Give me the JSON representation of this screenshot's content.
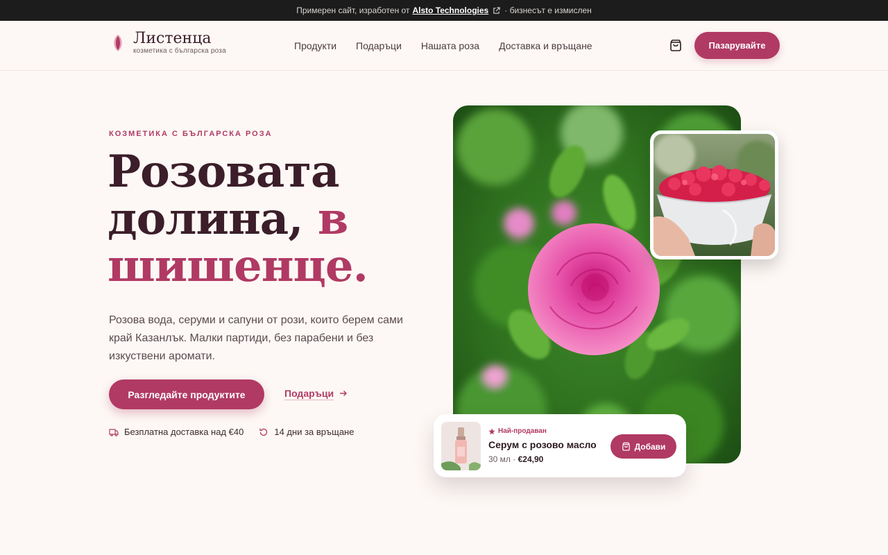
{
  "banner": {
    "prefix": "Примерен сайт, изработен от",
    "link": "Alsto Technologies",
    "suffix": "· бизнесът е измислен"
  },
  "brand": {
    "name": "Листенца",
    "tagline": "козметика с българска роза",
    "accent_color": "#b03a64"
  },
  "nav": {
    "items": [
      "Продукти",
      "Подаръци",
      "Нашата роза",
      "Доставка и връщане"
    ],
    "cart_icon": "shopping-bag-icon",
    "shop_label": "Пазарувайте"
  },
  "hero": {
    "eyebrow": "КОЗМЕТИКА С БЪЛГАРСКА РОЗА",
    "headline_line1": "Розовата",
    "headline_line2": "долина,",
    "headline_accent_1": "в",
    "headline_accent_2": "шишенце.",
    "lead": "Розова вода, серуми и сапуни от рози, които берем сами край Казанлък. Малки партиди, без парабени и без изкуствени аромати.",
    "cta_label": "Разгледайте продуктите",
    "secondary_link": "Подаръци",
    "perks": [
      {
        "icon": "truck-icon",
        "label": "Безплатна доставка над €40"
      },
      {
        "icon": "return-icon",
        "label": "14 дни за връщане"
      }
    ]
  },
  "featured_product": {
    "badge": "Най-продаван",
    "name": "Серум с розово масло",
    "volume": "30 мл",
    "separator": "·",
    "price": "€24,90",
    "add_label": "Добави"
  }
}
